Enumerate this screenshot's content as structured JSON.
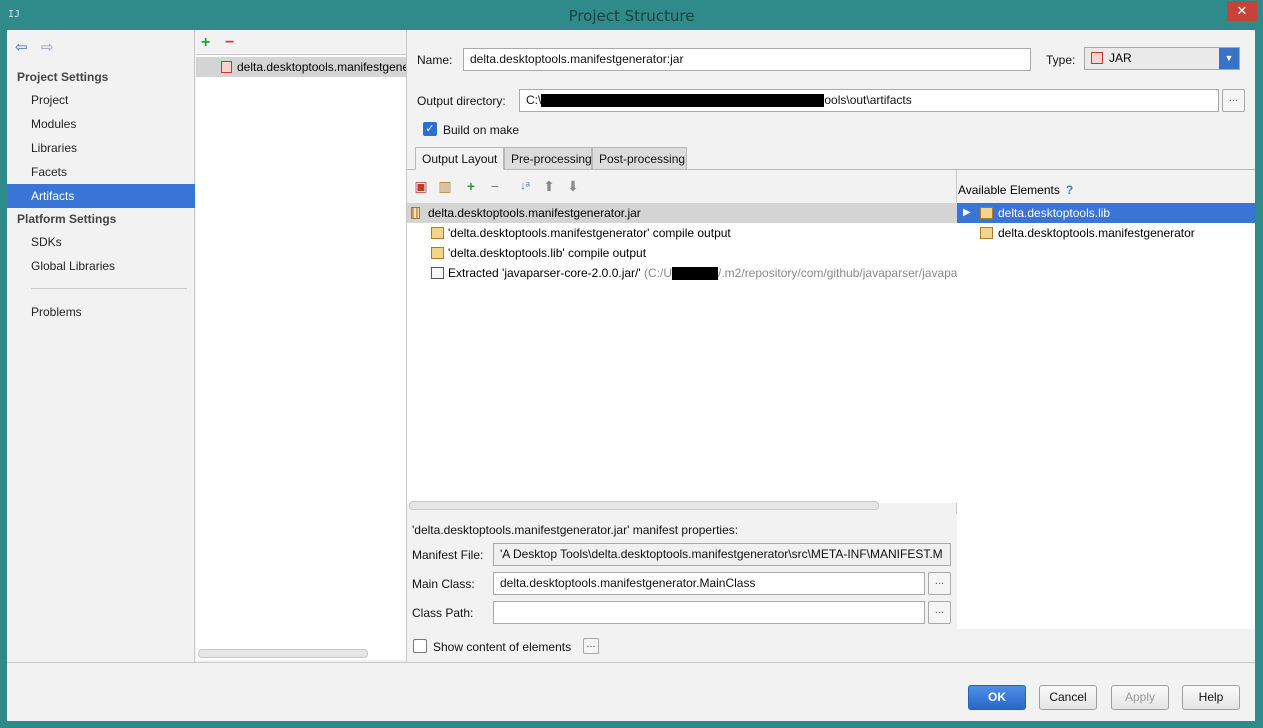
{
  "window": {
    "title": "Project Structure",
    "app_icon": "intellij-icon"
  },
  "nav": {
    "back_icon": "back-arrow-icon",
    "forward_icon": "forward-arrow-icon",
    "project_settings": "Project Settings",
    "project_items": [
      "Project",
      "Modules",
      "Libraries",
      "Facets",
      "Artifacts"
    ],
    "platform_settings": "Platform Settings",
    "platform_items": [
      "SDKs",
      "Global Libraries"
    ],
    "problems": "Problems",
    "selected": "Artifacts"
  },
  "artifacts": {
    "list": [
      "delta.desktoptools.manifestgenerator:jar"
    ]
  },
  "detail": {
    "name_label": "Name:",
    "name_value": "delta.desktoptools.manifestgenerator:jar",
    "type_label": "Type:",
    "type_value": "JAR",
    "output_label": "Output directory:",
    "output_prefix": "C:\\",
    "output_suffix": "ools\\out\\artifacts",
    "build_on_make": "Build on make",
    "build_on_make_checked": true,
    "tabs": [
      "Output Layout",
      "Pre-processing",
      "Post-processing"
    ],
    "active_tab": "Output Layout"
  },
  "layout_tree": {
    "root": "delta.desktoptools.manifestgenerator.jar",
    "children": [
      {
        "text": "'delta.desktoptools.manifestgenerator' compile output",
        "icon": "folder-icon"
      },
      {
        "text": "'delta.desktoptools.lib' compile output",
        "icon": "folder-icon"
      },
      {
        "text": "Extracted 'javaparser-core-2.0.0.jar/'",
        "path_prefix": "(C:/U",
        "path_suffix": "/.m2/repository/com/github/javaparser/javapa",
        "icon": "extracted-icon"
      }
    ]
  },
  "available": {
    "title": "Available Elements",
    "help": "?",
    "items": [
      "delta.desktoptools.lib",
      "delta.desktoptools.manifestgenerator"
    ],
    "selected": "delta.desktoptools.lib"
  },
  "manifest": {
    "title": "'delta.desktoptools.manifestgenerator.jar' manifest properties:",
    "file_label": "Manifest File:",
    "file_value": "'A Desktop Tools\\delta.desktoptools.manifestgenerator\\src\\META-INF\\MANIFEST.M",
    "main_class_label": "Main Class:",
    "main_class_value": "delta.desktoptools.manifestgenerator.MainClass",
    "class_path_label": "Class Path:",
    "class_path_value": "",
    "show_content": "Show content of elements",
    "show_content_checked": false,
    "dots": "..."
  },
  "footer": {
    "ok": "OK",
    "cancel": "Cancel",
    "apply": "Apply",
    "help": "Help"
  }
}
